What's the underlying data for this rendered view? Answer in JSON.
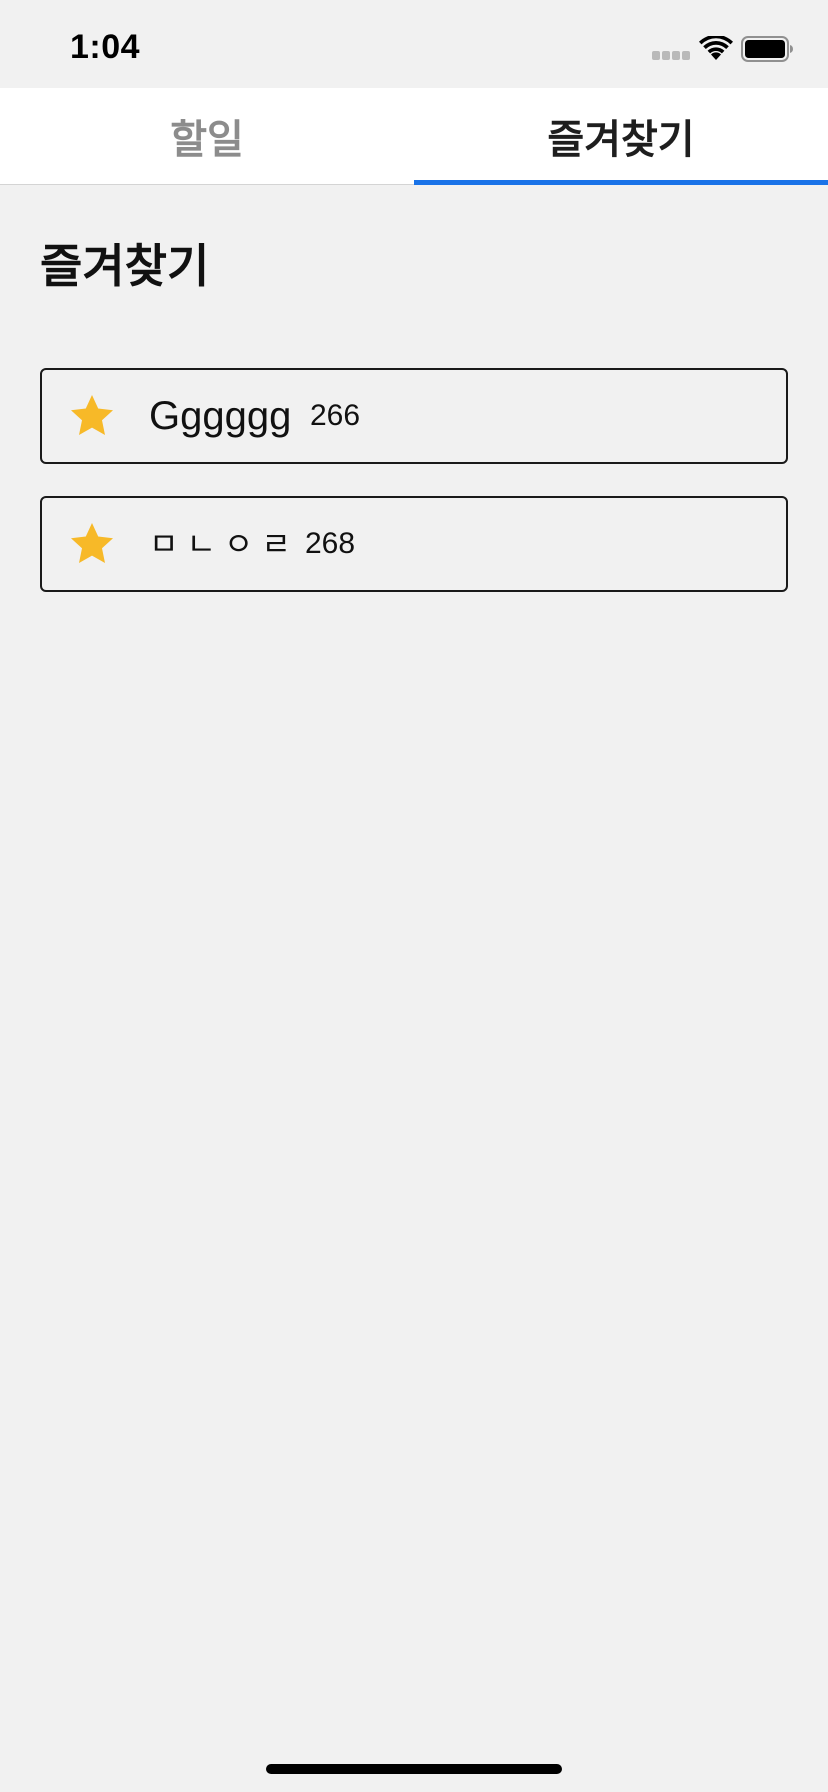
{
  "status_bar": {
    "time": "1:04",
    "icons": [
      "signal-icon",
      "wifi-icon",
      "battery-icon"
    ]
  },
  "tabs": [
    {
      "label": "할일",
      "selected": false
    },
    {
      "label": "즐겨찾기",
      "selected": true
    }
  ],
  "colors": {
    "accent": "#1a73e8",
    "star": "#f7b928",
    "background": "#f1f1f1"
  },
  "page": {
    "title": "즐겨찾기"
  },
  "favorites": [
    {
      "icon": "star-icon",
      "name": "Gggggg",
      "count": "266"
    },
    {
      "icon": "star-icon",
      "name": "ㅁㄴㅇㄹ",
      "count": "268"
    }
  ]
}
